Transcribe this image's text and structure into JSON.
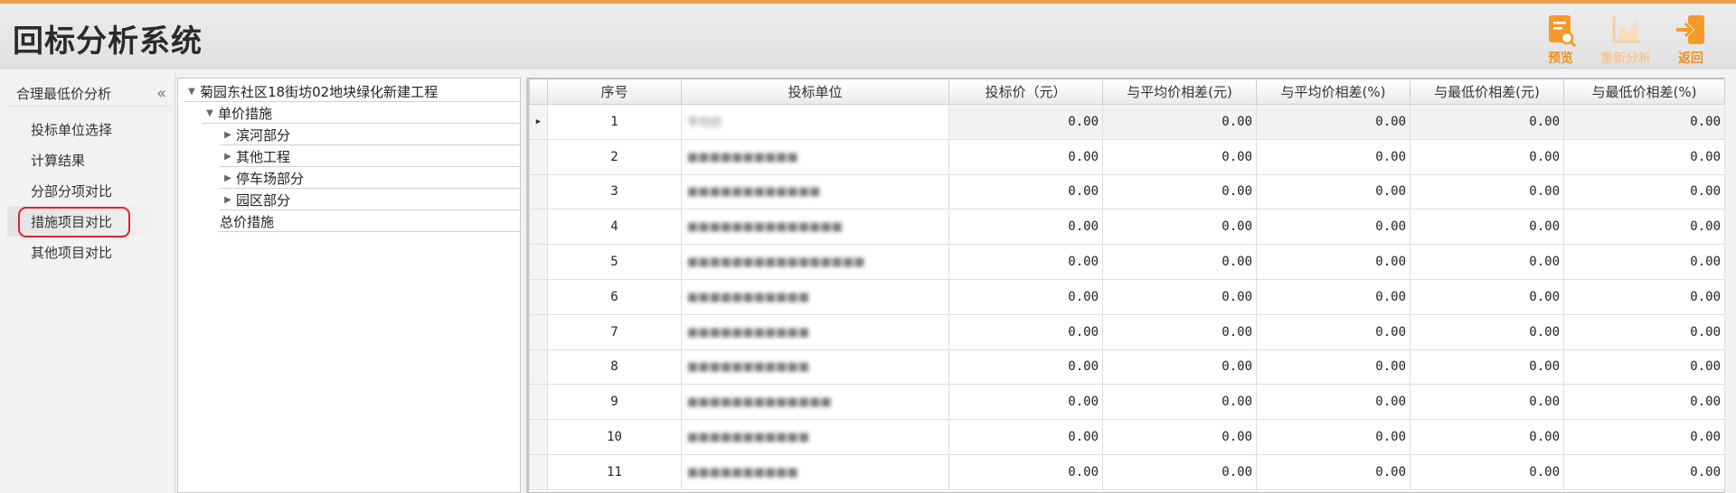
{
  "app": {
    "title": "回标分析系统"
  },
  "toolbar": {
    "preview_label": "预览",
    "reanalyze_label": "重新分析",
    "back_label": "返回",
    "accent_color": "#f09020"
  },
  "nav": {
    "header_label": "合理最低价分析",
    "collapse_symbol": "«",
    "items": [
      {
        "label": "投标单位选择"
      },
      {
        "label": "计算结果"
      },
      {
        "label": "分部分项对比"
      },
      {
        "label": "措施项目对比",
        "active": true
      },
      {
        "label": "其他项目对比"
      }
    ]
  },
  "tree": {
    "root": "菊园东社区18街坊02地块绿化新建工程",
    "level1": "单价措施",
    "children": [
      "滨河部分",
      "其他工程",
      "停车场部分",
      "园区部分"
    ],
    "total": "总价措施"
  },
  "grid": {
    "columns": [
      "序号",
      "投标单位",
      "投标价（元）",
      "与平均价相差(元)",
      "与平均价相差(%)",
      "与最低价相差(元)",
      "与最低价相差(%)"
    ],
    "rows": [
      {
        "seq": "1",
        "unit": "平均价",
        "v1": "0.00",
        "v2": "0.00",
        "v3": "0.00",
        "v4": "0.00",
        "v5": "0.00"
      },
      {
        "seq": "2",
        "unit": "■■■■■■■■■■",
        "v1": "0.00",
        "v2": "0.00",
        "v3": "0.00",
        "v4": "0.00",
        "v5": "0.00"
      },
      {
        "seq": "3",
        "unit": "■■■■■■■■■■■■",
        "v1": "0.00",
        "v2": "0.00",
        "v3": "0.00",
        "v4": "0.00",
        "v5": "0.00"
      },
      {
        "seq": "4",
        "unit": "■■■■■■■■■■■■■■",
        "v1": "0.00",
        "v2": "0.00",
        "v3": "0.00",
        "v4": "0.00",
        "v5": "0.00"
      },
      {
        "seq": "5",
        "unit": "■■■■■■■■■■■■■■■■",
        "v1": "0.00",
        "v2": "0.00",
        "v3": "0.00",
        "v4": "0.00",
        "v5": "0.00"
      },
      {
        "seq": "6",
        "unit": "■■■■■■■■■■■",
        "v1": "0.00",
        "v2": "0.00",
        "v3": "0.00",
        "v4": "0.00",
        "v5": "0.00"
      },
      {
        "seq": "7",
        "unit": "■■■■■■■■■■■",
        "v1": "0.00",
        "v2": "0.00",
        "v3": "0.00",
        "v4": "0.00",
        "v5": "0.00"
      },
      {
        "seq": "8",
        "unit": "■■■■■■■■■■■",
        "v1": "0.00",
        "v2": "0.00",
        "v3": "0.00",
        "v4": "0.00",
        "v5": "0.00"
      },
      {
        "seq": "9",
        "unit": "■■■■■■■■■■■■■",
        "v1": "0.00",
        "v2": "0.00",
        "v3": "0.00",
        "v4": "0.00",
        "v5": "0.00"
      },
      {
        "seq": "10",
        "unit": "■■■■■■■■■■■",
        "v1": "0.00",
        "v2": "0.00",
        "v3": "0.00",
        "v4": "0.00",
        "v5": "0.00"
      },
      {
        "seq": "11",
        "unit": "■■■■■■■■■■",
        "v1": "0.00",
        "v2": "0.00",
        "v3": "0.00",
        "v4": "0.00",
        "v5": "0.00"
      }
    ],
    "current_row_marker": "▶"
  }
}
